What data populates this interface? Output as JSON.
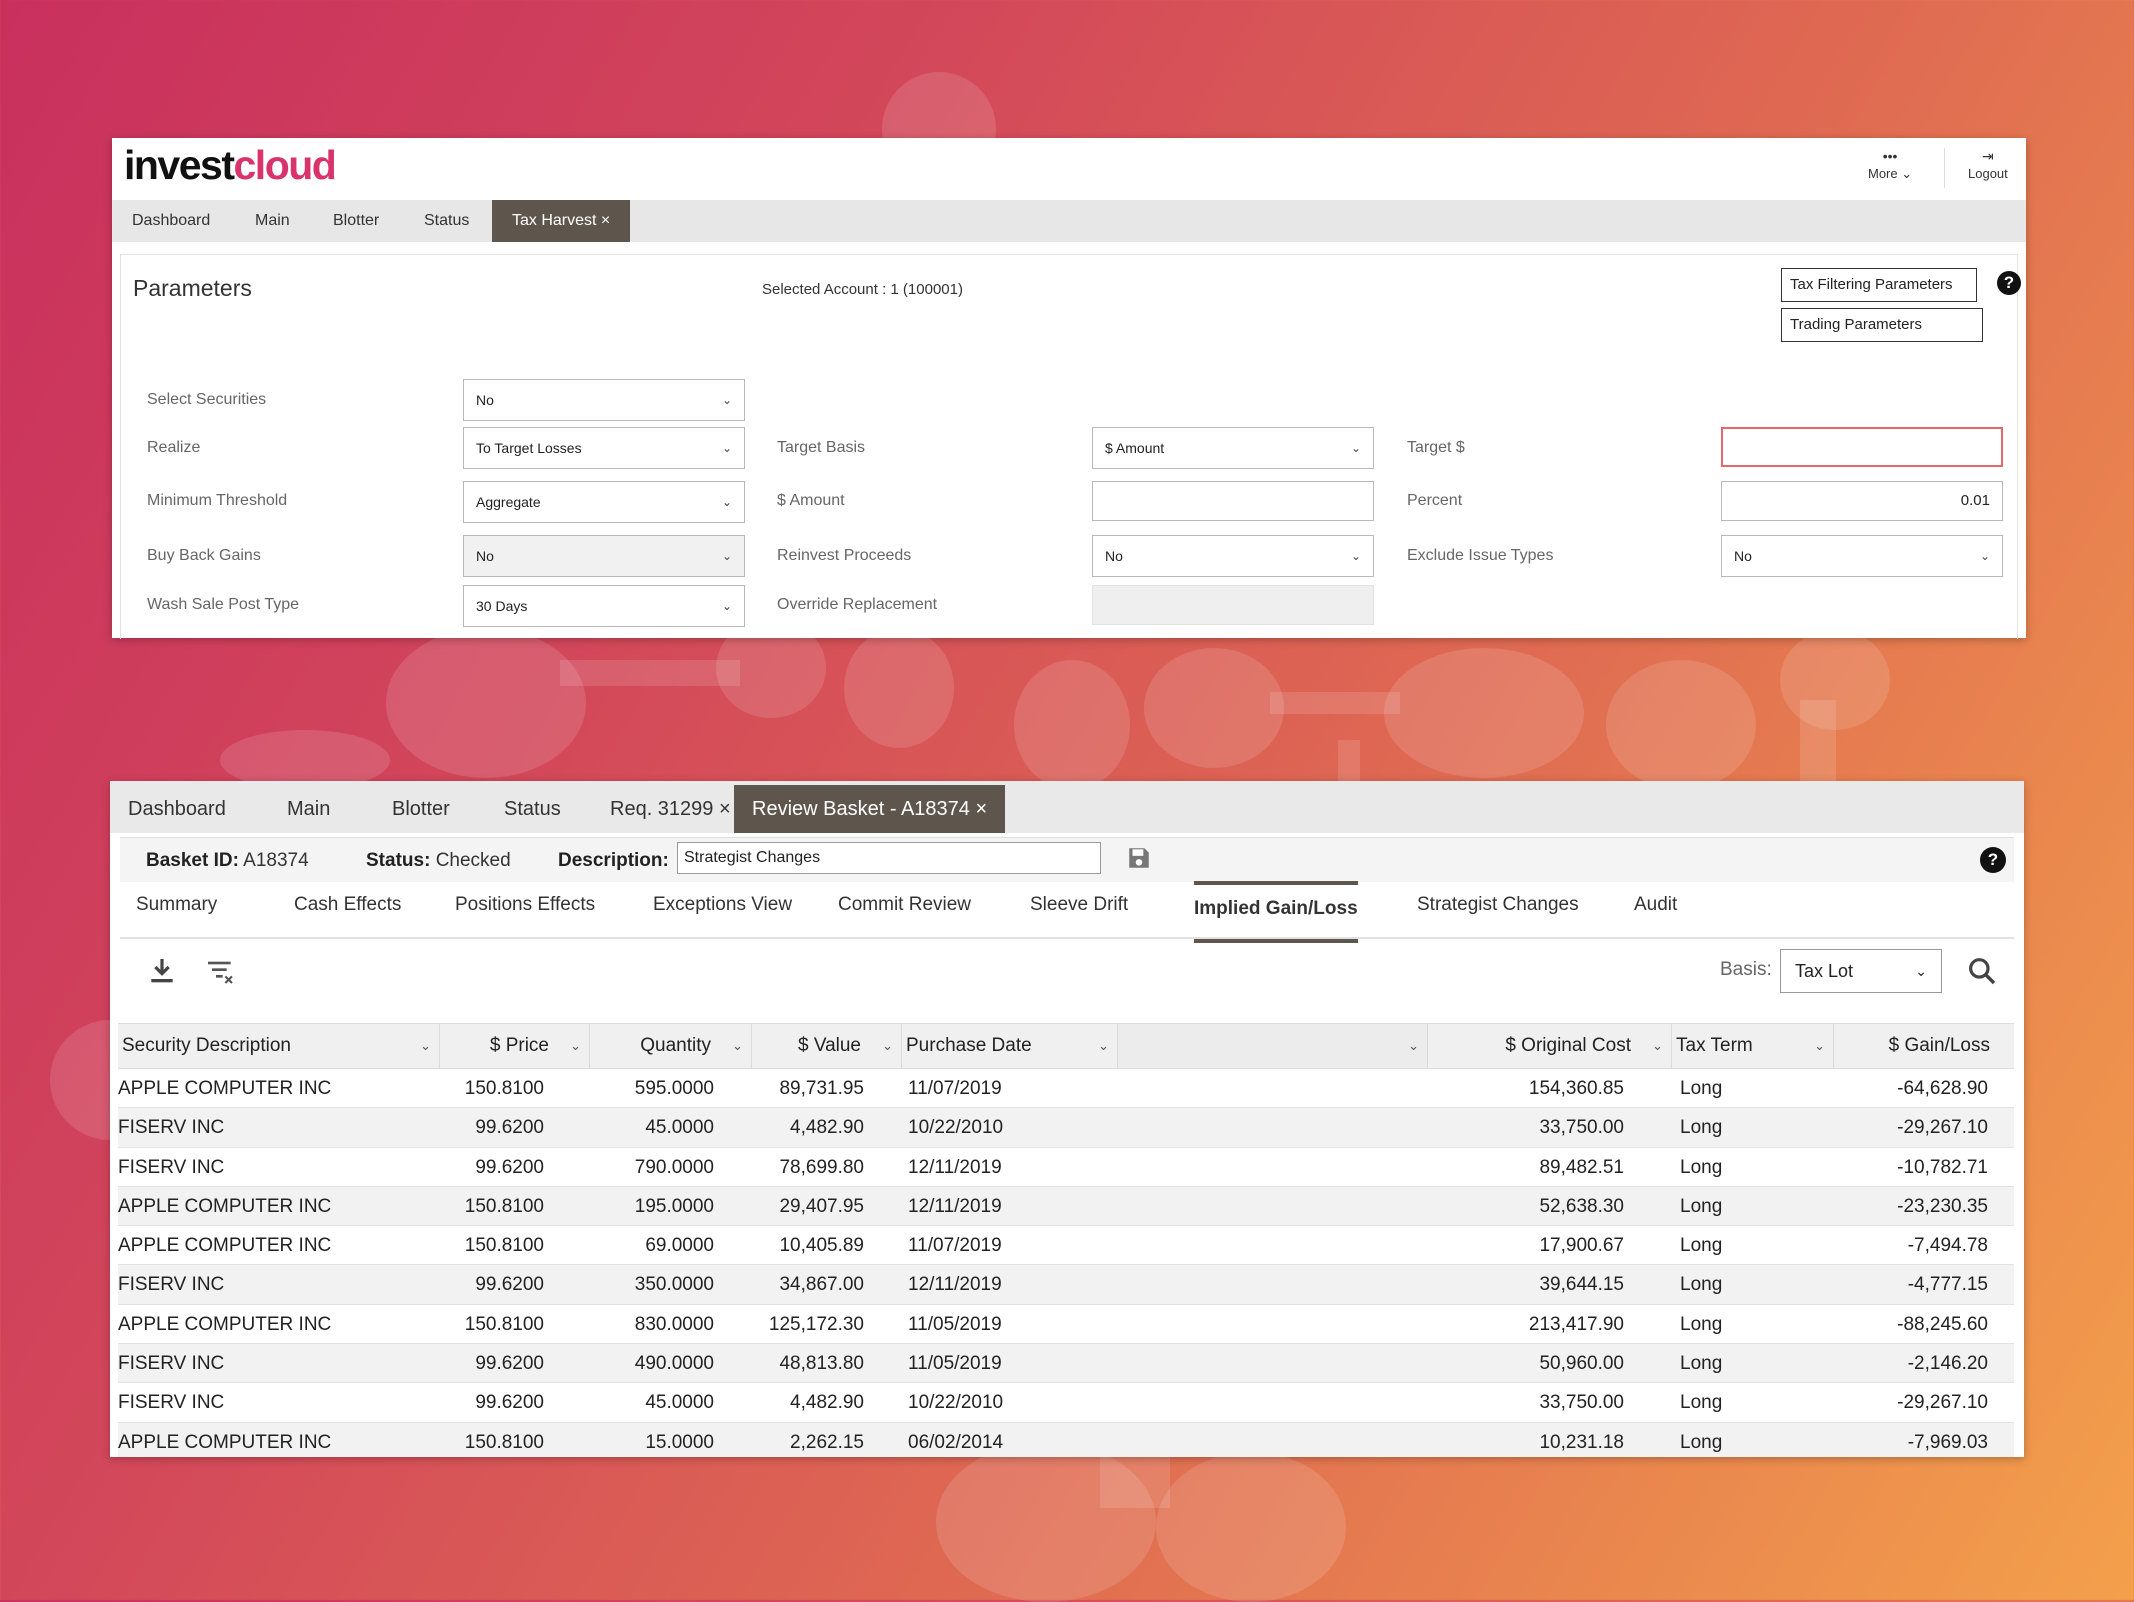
{
  "brand": {
    "logo_part1": "invest",
    "logo_part2": "cloud"
  },
  "header": {
    "more_label": "More",
    "logout_label": "Logout"
  },
  "tabs_top": [
    {
      "label": "Dashboard"
    },
    {
      "label": "Main"
    },
    {
      "label": "Blotter"
    },
    {
      "label": "Status"
    },
    {
      "label": "Tax Harvest ×"
    }
  ],
  "parameters": {
    "title": "Parameters",
    "selected_account": "Selected Account : 1 (100001)",
    "tax_filtering_button": "Tax Filtering Parameters",
    "trading_params_button": "Trading Parameters",
    "help": "?",
    "fields": {
      "select_securities": {
        "label": "Select Securities",
        "value": "No"
      },
      "realize": {
        "label": "Realize",
        "value": "To Target Losses"
      },
      "minimum_threshold": {
        "label": "Minimum Threshold",
        "value": "Aggregate"
      },
      "buy_back_gains": {
        "label": "Buy Back Gains",
        "value": "No"
      },
      "wash_sale_post_type": {
        "label": "Wash Sale Post Type",
        "value": "30 Days"
      },
      "target_basis": {
        "label": "Target Basis",
        "value": "$ Amount"
      },
      "amount": {
        "label": "$ Amount",
        "value": ""
      },
      "reinvest_proceeds": {
        "label": "Reinvest Proceeds",
        "value": "No"
      },
      "override_replacement": {
        "label": "Override Replacement",
        "value": ""
      },
      "target_dollar": {
        "label": "Target $",
        "value": ""
      },
      "percent": {
        "label": "Percent",
        "value": "0.01"
      },
      "exclude_issue_types": {
        "label": "Exclude Issue Types",
        "value": "No"
      }
    }
  },
  "tabs_bottom": [
    {
      "label": "Dashboard"
    },
    {
      "label": "Main"
    },
    {
      "label": "Blotter"
    },
    {
      "label": "Status"
    },
    {
      "label": "Req. 31299 ×"
    },
    {
      "label": "Review Basket - A18374 ×"
    }
  ],
  "basket": {
    "id_label": "Basket ID:",
    "id_value": "A18374",
    "status_label": "Status:",
    "status_value": "Checked",
    "description_label": "Description:",
    "description_value": "Strategist Changes",
    "help": "?"
  },
  "subtabs": [
    {
      "label": "Summary"
    },
    {
      "label": "Cash Effects"
    },
    {
      "label": "Positions Effects"
    },
    {
      "label": "Exceptions View"
    },
    {
      "label": "Commit Review"
    },
    {
      "label": "Sleeve Drift"
    },
    {
      "label": "Implied Gain/Loss"
    },
    {
      "label": "Strategist Changes"
    },
    {
      "label": "Audit"
    }
  ],
  "toolbar": {
    "basis_label": "Basis:",
    "basis_value": "Tax Lot"
  },
  "table": {
    "columns": [
      {
        "label": "Security Description"
      },
      {
        "label": "$ Price"
      },
      {
        "label": "Quantity"
      },
      {
        "label": "$ Value"
      },
      {
        "label": "Purchase Date"
      },
      {
        "label": ""
      },
      {
        "label": "$ Original Cost"
      },
      {
        "label": "Tax Term"
      },
      {
        "label": "$ Gain/Loss"
      }
    ],
    "rows": [
      [
        "APPLE COMPUTER INC",
        "150.8100",
        "595.0000",
        "89,731.95",
        "11/07/2019",
        "154,360.85",
        "Long",
        "-64,628.90"
      ],
      [
        "FISERV INC",
        "99.6200",
        "45.0000",
        "4,482.90",
        "10/22/2010",
        "33,750.00",
        "Long",
        "-29,267.10"
      ],
      [
        "FISERV INC",
        "99.6200",
        "790.0000",
        "78,699.80",
        "12/11/2019",
        "89,482.51",
        "Long",
        "-10,782.71"
      ],
      [
        "APPLE COMPUTER INC",
        "150.8100",
        "195.0000",
        "29,407.95",
        "12/11/2019",
        "52,638.30",
        "Long",
        "-23,230.35"
      ],
      [
        "APPLE COMPUTER INC",
        "150.8100",
        "69.0000",
        "10,405.89",
        "11/07/2019",
        "17,900.67",
        "Long",
        "-7,494.78"
      ],
      [
        "FISERV INC",
        "99.6200",
        "350.0000",
        "34,867.00",
        "12/11/2019",
        "39,644.15",
        "Long",
        "-4,777.15"
      ],
      [
        "APPLE COMPUTER INC",
        "150.8100",
        "830.0000",
        "125,172.30",
        "11/05/2019",
        "213,417.90",
        "Long",
        "-88,245.60"
      ],
      [
        "FISERV INC",
        "99.6200",
        "490.0000",
        "48,813.80",
        "11/05/2019",
        "50,960.00",
        "Long",
        "-2,146.20"
      ],
      [
        "FISERV INC",
        "99.6200",
        "45.0000",
        "4,482.90",
        "10/22/2010",
        "33,750.00",
        "Long",
        "-29,267.10"
      ],
      [
        "APPLE COMPUTER INC",
        "150.8100",
        "15.0000",
        "2,262.15",
        "06/02/2014",
        "10,231.18",
        "Long",
        "-7,969.03"
      ]
    ]
  }
}
